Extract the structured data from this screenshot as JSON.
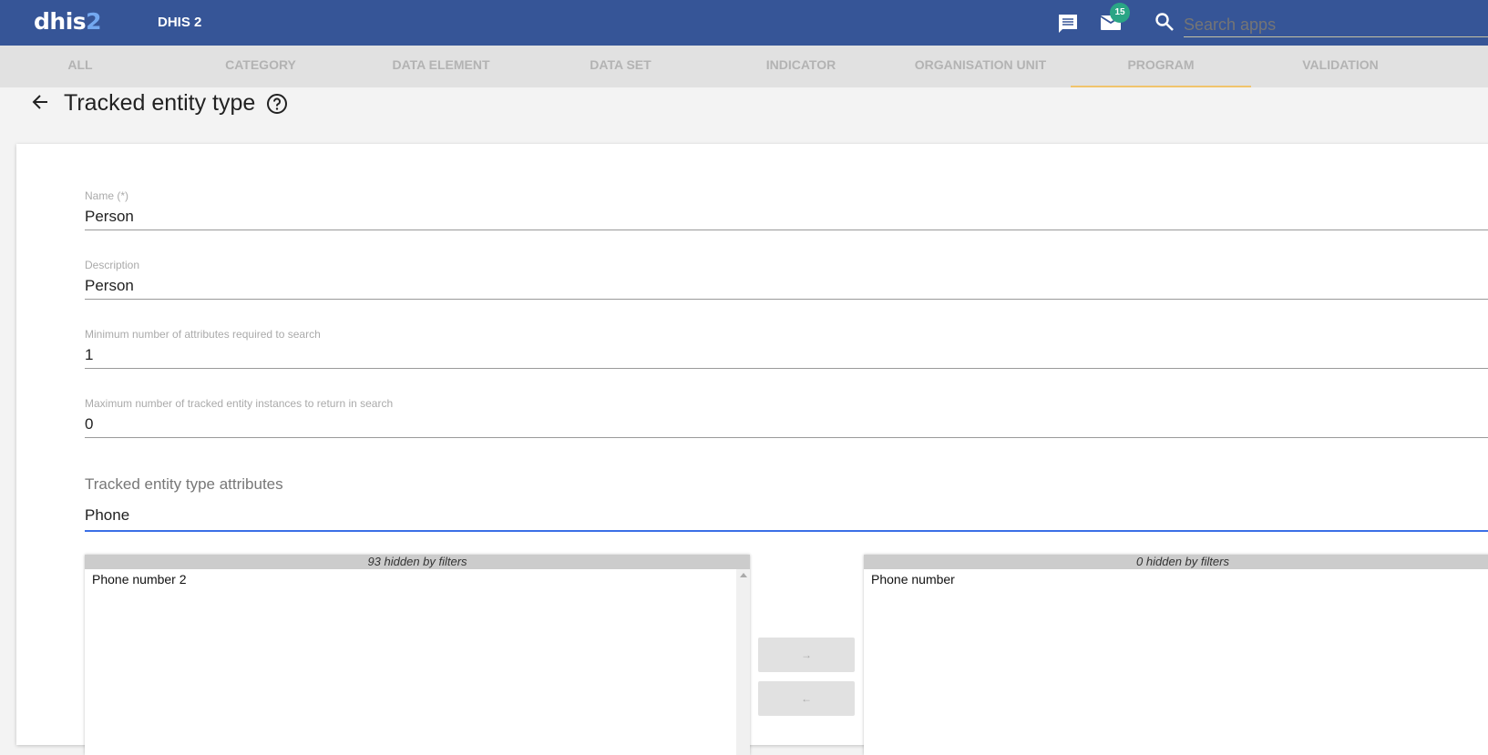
{
  "header": {
    "logo_main": "dhis",
    "logo_accent": "2",
    "app_title": "DHIS 2",
    "mail_count": "15",
    "search_placeholder": "Search apps"
  },
  "tabs": [
    "ALL",
    "CATEGORY",
    "DATA ELEMENT",
    "DATA SET",
    "INDICATOR",
    "ORGANISATION UNIT",
    "PROGRAM",
    "VALIDATION"
  ],
  "active_tab": "PROGRAM",
  "page": {
    "title": "Tracked entity type"
  },
  "form": {
    "name": {
      "label": "Name (*)",
      "value": "Person"
    },
    "description": {
      "label": "Description",
      "value": "Person"
    },
    "min_attrs": {
      "label": "Minimum number of attributes required to search",
      "value": "1"
    },
    "max_tei": {
      "label": "Maximum number of tracked entity instances to return in search",
      "value": "0"
    },
    "attributes_section": "Tracked entity type attributes",
    "filter_value": "Phone"
  },
  "available": {
    "header": "93 hidden by filters",
    "items": [
      "Phone number 2"
    ]
  },
  "selected": {
    "header": "0 hidden by filters",
    "items": [
      "Phone number"
    ]
  },
  "buttons": {
    "add": "→",
    "remove": "←"
  }
}
